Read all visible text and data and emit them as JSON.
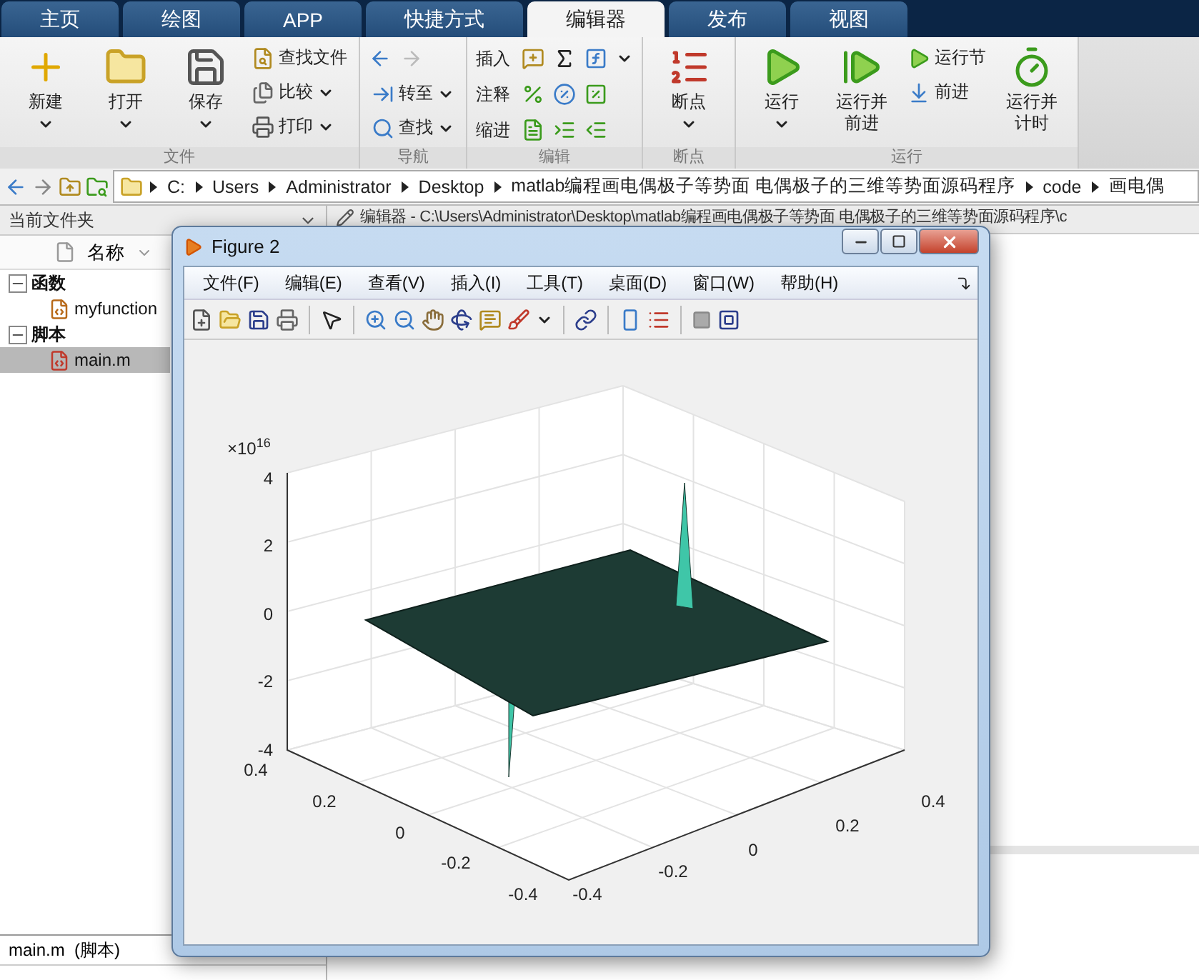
{
  "tabs": [
    {
      "label": "主页",
      "selected": false
    },
    {
      "label": "绘图",
      "selected": false
    },
    {
      "label": "APP",
      "selected": false
    },
    {
      "label": "快捷方式",
      "selected": false
    },
    {
      "label": "编辑器",
      "selected": true
    },
    {
      "label": "发布",
      "selected": false
    },
    {
      "label": "视图",
      "selected": false
    }
  ],
  "ribbon": {
    "groups": [
      {
        "label": "文件",
        "items": [
          {
            "kind": "large",
            "label": "新建",
            "dropdown": true
          },
          {
            "kind": "large",
            "label": "打开",
            "dropdown": true
          },
          {
            "kind": "large",
            "label": "保存",
            "dropdown": true
          },
          {
            "kind": "stack",
            "entries": [
              {
                "label": "查找文件",
                "dropdown": false
              },
              {
                "label": "比较",
                "dropdown": true
              },
              {
                "label": "打印",
                "dropdown": true
              }
            ]
          }
        ]
      },
      {
        "label": "导航",
        "items": [
          {
            "kind": "stack",
            "entries": [
              {
                "kind": "arrows"
              },
              {
                "label": "转至",
                "dropdown": true
              },
              {
                "label": "查找",
                "dropdown": true
              }
            ]
          }
        ]
      },
      {
        "label": "编辑",
        "items": [
          {
            "kind": "rows",
            "rows": [
              {
                "label": "插入",
                "dropdown": true
              },
              {
                "label": "注释",
                "dropdown": false
              },
              {
                "label": "缩进",
                "dropdown": false
              }
            ]
          }
        ]
      },
      {
        "label": "断点",
        "items": [
          {
            "kind": "large",
            "label": "断点",
            "dropdown": true
          }
        ]
      },
      {
        "label": "运行",
        "items": [
          {
            "kind": "large",
            "label": "运行",
            "dropdown": true
          },
          {
            "kind": "large",
            "label": "运行并前进",
            "dropdown": false
          },
          {
            "kind": "stack",
            "entries": [
              {
                "label": "运行节",
                "dropdown": false
              },
              {
                "label": "前进",
                "dropdown": false
              }
            ]
          },
          {
            "kind": "large",
            "label": "运行并计时",
            "dropdown": false
          }
        ]
      }
    ]
  },
  "address": {
    "segments": [
      "C:",
      "Users",
      "Administrator",
      "Desktop",
      "matlab编程画电偶极子等势面 电偶极子的三维等势面源码程序",
      "code",
      "画电偶"
    ]
  },
  "folder_panel": {
    "title": "当前文件夹",
    "column": "名称",
    "tree": [
      {
        "label": "函数",
        "expanded": true,
        "children": [
          {
            "label": "myfunction",
            "kind": "function",
            "selected": false
          }
        ]
      },
      {
        "label": "脚本",
        "expanded": true,
        "children": [
          {
            "label": "main.m",
            "kind": "script",
            "selected": true
          }
        ]
      }
    ],
    "details": "main.m  (脚本)"
  },
  "editor": {
    "title": "编辑器 - C:\\Users\\Administrator\\Desktop\\matlab编程画电偶极子等势面 电偶极子的三维等势面源码程序\\c"
  },
  "figure": {
    "title": "Figure 2",
    "menus": [
      "文件(F)",
      "编辑(E)",
      "查看(V)",
      "插入(I)",
      "工具(T)",
      "桌面(D)",
      "窗口(W)",
      "帮助(H)"
    ],
    "axes": {
      "exponent_base": "×10",
      "exponent": "16",
      "z_ticks": [
        "4",
        "2",
        "0",
        "-2",
        "-4"
      ],
      "x_ticks": [
        "0.4",
        "0.2",
        "0",
        "-0.2",
        "-0.4"
      ],
      "y_ticks": [
        "-0.4",
        "-0.2",
        "0",
        "0.2",
        "0.4"
      ]
    }
  }
}
